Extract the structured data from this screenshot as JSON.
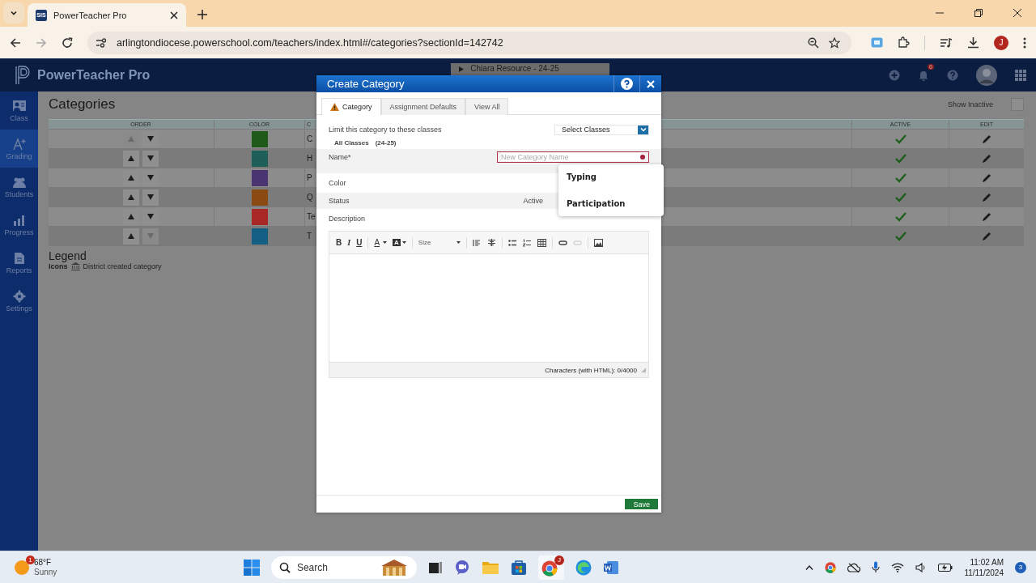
{
  "browser": {
    "tabs": [
      {
        "title": "PowerTeacher Pro",
        "favicon": "SIS",
        "selected": true
      }
    ],
    "url": "arlingtondiocese.powerschool.com/teachers/index.html#/categories?sectionId=142742",
    "profile": "J"
  },
  "app": {
    "title": "PowerTeacher Pro",
    "section": "Chiara Resource - 24-25",
    "notifications": "6"
  },
  "sidebar": {
    "items": [
      {
        "label": "Class",
        "selected": false
      },
      {
        "label": "Grading",
        "selected": true
      },
      {
        "label": "Students",
        "selected": false
      },
      {
        "label": "Progress",
        "selected": false
      },
      {
        "label": "Reports",
        "selected": false
      },
      {
        "label": "Settings",
        "selected": false
      }
    ]
  },
  "page": {
    "title": "Categories",
    "show_inactive": {
      "label": "Show Inactive",
      "checked": false
    }
  },
  "table": {
    "columns": [
      "ORDER",
      "COLOR",
      "C",
      "ACTIVE",
      "EDIT"
    ],
    "rows": [
      {
        "name": "C",
        "color": "#1f5a1a",
        "up_enabled": false,
        "down_enabled": true,
        "active": true
      },
      {
        "name": "H",
        "color": "#1e5f58",
        "up_enabled": true,
        "down_enabled": true,
        "active": true
      },
      {
        "name": "P",
        "color": "#4b3472",
        "up_enabled": true,
        "down_enabled": true,
        "active": true
      },
      {
        "name": "Q",
        "color": "#8a4a12",
        "up_enabled": true,
        "down_enabled": true,
        "active": true
      },
      {
        "name": "Te",
        "color": "#a82828",
        "up_enabled": true,
        "down_enabled": true,
        "active": true
      },
      {
        "name": "T",
        "color": "#155f85",
        "up_enabled": true,
        "down_enabled": false,
        "active": true
      }
    ]
  },
  "legend": {
    "title": "Legend",
    "label": "Icons",
    "text": "District created category"
  },
  "dialog": {
    "title": "Create Category",
    "tabs": [
      {
        "label": "Category",
        "selected": true,
        "warning": true
      },
      {
        "label": "Assignment Defaults",
        "selected": false,
        "warning": false
      },
      {
        "label": "View All",
        "selected": false,
        "warning": false
      }
    ],
    "limit_label": "Limit this category to these classes",
    "select_classes": "Select Classes",
    "classes_name": "All Classes",
    "classes_year": "(24-25)",
    "name_label": "Name*",
    "name_placeholder": "New Category Name",
    "name_invalid": true,
    "color_label": "Color",
    "status_label": "Status",
    "status_value": "Active",
    "description_label": "Description",
    "toolbar": [
      {
        "kind": "bold",
        "label": "B"
      },
      {
        "kind": "italic",
        "label": "I"
      },
      {
        "kind": "underline",
        "label": "U"
      },
      {
        "kind": "sep"
      },
      {
        "kind": "text-color",
        "label": "A"
      },
      {
        "kind": "bg-color",
        "label": "A"
      },
      {
        "kind": "sep"
      },
      {
        "kind": "size",
        "label": "Size"
      },
      {
        "kind": "sep"
      },
      {
        "kind": "align-left"
      },
      {
        "kind": "align-center"
      },
      {
        "kind": "sep"
      },
      {
        "kind": "bullets"
      },
      {
        "kind": "numbers"
      },
      {
        "kind": "table"
      },
      {
        "kind": "sep"
      },
      {
        "kind": "link"
      },
      {
        "kind": "unlink",
        "disabled": true
      },
      {
        "kind": "sep"
      },
      {
        "kind": "image"
      }
    ],
    "char_count": "Characters (with HTML): 0/4000",
    "save": "Save",
    "suggestions": [
      "Typing",
      "Participation"
    ]
  },
  "taskbar": {
    "weather_badge": "1",
    "temperature": "68°F",
    "weather": "Sunny",
    "search": "Search",
    "chrome_badge": "J",
    "time": "11:02 AM",
    "date": "11/11/2024",
    "notifications": "3"
  }
}
